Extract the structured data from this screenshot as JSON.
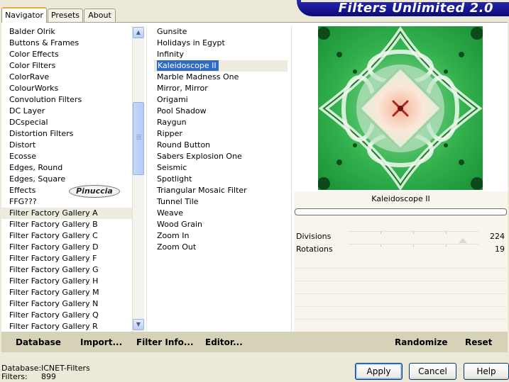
{
  "app": {
    "title": "Filters Unlimited 2.0"
  },
  "tabs": [
    {
      "label": "Navigator",
      "active": true
    },
    {
      "label": "Presets",
      "active": false
    },
    {
      "label": "About",
      "active": false
    }
  ],
  "categories": {
    "items": [
      "Balder Olrik",
      "Buttons & Frames",
      "Color Effects",
      "Color Filters",
      "ColorRave",
      "ColourWorks",
      "Convolution Filters",
      "DC Layer",
      "DCspecial",
      "Distortion Filters",
      "Distort",
      "Ecosse",
      "Edges, Round",
      "Edges, Square",
      "Effects",
      "FFG???",
      "Filter Factory Gallery A",
      "Filter Factory Gallery B",
      "Filter Factory Gallery C",
      "Filter Factory Gallery D",
      "Filter Factory Gallery F",
      "Filter Factory Gallery G",
      "Filter Factory Gallery H",
      "Filter Factory Gallery M",
      "Filter Factory Gallery N",
      "Filter Factory Gallery Q",
      "Filter Factory Gallery R"
    ],
    "selected": "Filter Factory Gallery A"
  },
  "filters": {
    "items": [
      "Gunsite",
      "Holidays in Egypt",
      "Infinity",
      "Kaleidoscope II",
      "Marble Madness One",
      "Mirror, Mirror",
      "Origami",
      "Pool Shadow",
      "Raygun",
      "Ripper",
      "Round Button",
      "Sabers Explosion One",
      "Seismic",
      "Spotlight",
      "Triangular Mosaic Filter",
      "Tunnel Tile",
      "Weave",
      "Wood Grain",
      "Zoom In",
      "Zoom Out"
    ],
    "selected": "Kaleidoscope II"
  },
  "watermark": "Pinuccia",
  "preview": {
    "filter_name": "Kaleidoscope II"
  },
  "parameters": [
    {
      "name": "Divisions",
      "value": "224",
      "level": 224,
      "max": 255
    },
    {
      "name": "Rotations",
      "value": "19",
      "level": 19,
      "max": 255
    }
  ],
  "toolbar": {
    "database": "Database",
    "import": "Import...",
    "filter_info": "Filter Info...",
    "editor": "Editor...",
    "randomize": "Randomize",
    "reset": "Reset"
  },
  "footer": {
    "database_label": "Database:",
    "database_value": "ICNET-Filters",
    "filters_label": "Filters:",
    "filters_value": "899",
    "apply": "Apply",
    "cancel": "Cancel",
    "help": "Help"
  },
  "colors": {
    "banner": "#0A0A7C",
    "selection": "#316AC5",
    "button_strip": "#D6D2B8",
    "window": "#ECE9D8"
  }
}
